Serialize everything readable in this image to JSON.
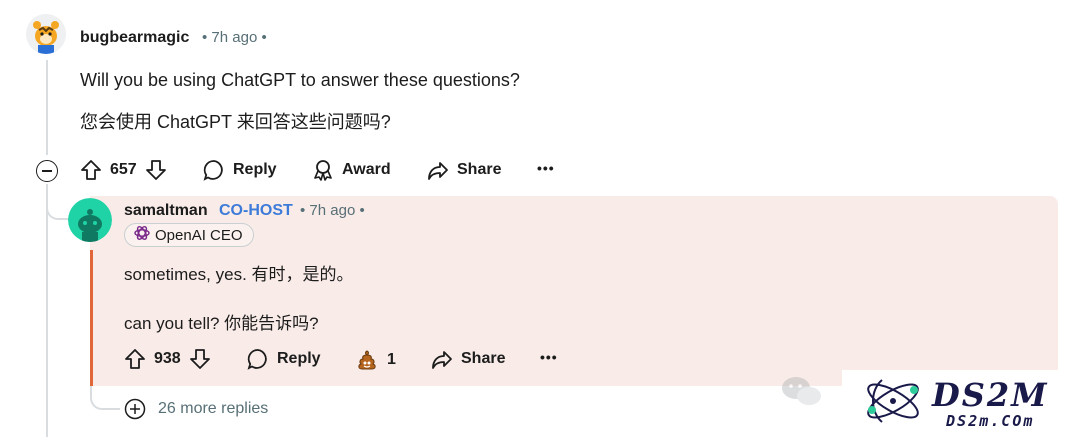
{
  "comment": {
    "username": "bugbearmagic",
    "time": "7h ago",
    "text_en": "Will you be using ChatGPT to answer these questions?",
    "text_zh": "您会使用 ChatGPT 来回答这些问题吗?",
    "votes": "657",
    "reply_label": "Reply",
    "award_label": "Award",
    "share_label": "Share",
    "more_label": "•••"
  },
  "reply": {
    "username": "samaltman",
    "badge": "CO-HOST",
    "time": "7h ago",
    "flair": "OpenAI CEO",
    "line1": "sometimes, yes.  有时，是的。",
    "line2": "can you tell?  你能告诉吗?",
    "votes": "938",
    "reply_label": "Reply",
    "award_count": "1",
    "share_label": "Share",
    "more_label": "•••"
  },
  "more_replies": "26 more replies",
  "watermark": {
    "brand": "DS2M",
    "domain": "DS2m.COm"
  },
  "colors": {
    "cohost": "#3d7bd9",
    "reply_bg": "#f9ece8",
    "rail": "#e0673a",
    "meta": "#576f76"
  }
}
